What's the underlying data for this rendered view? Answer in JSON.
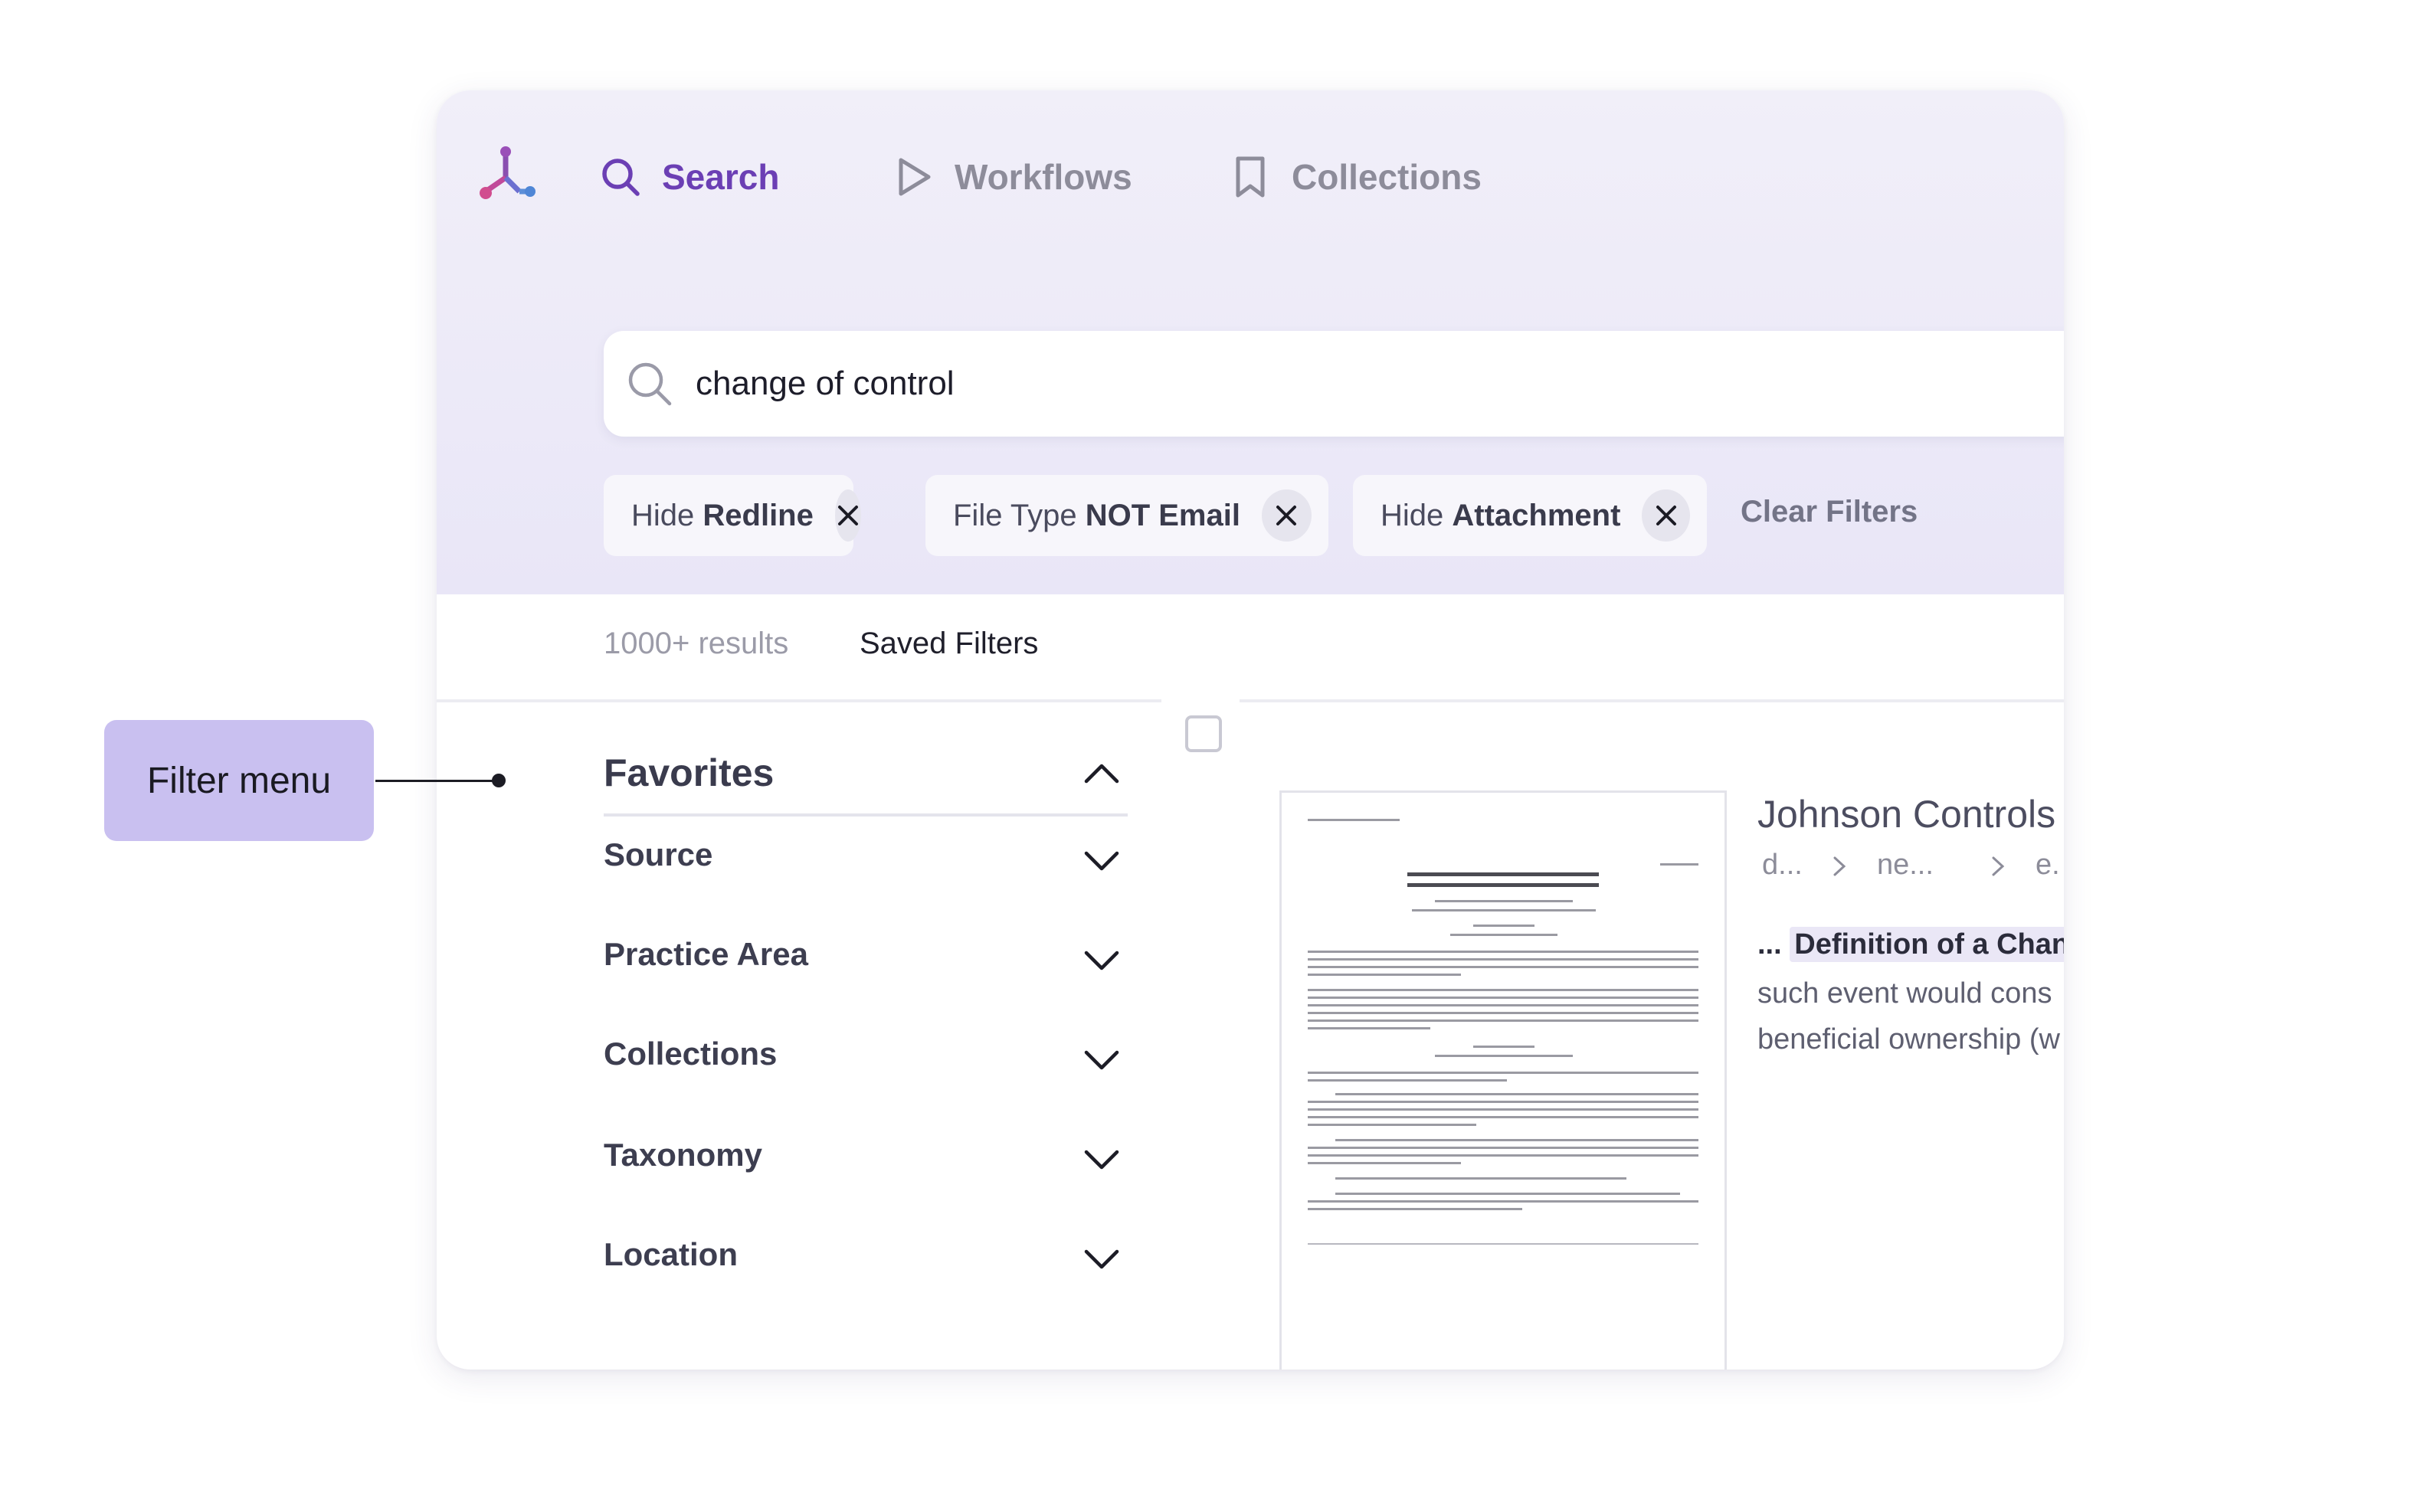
{
  "nav": {
    "tabs": [
      {
        "label": "Search",
        "icon": "search-icon",
        "active": true
      },
      {
        "label": "Workflows",
        "icon": "play-icon",
        "active": false
      },
      {
        "label": "Collections",
        "icon": "bookmark-icon",
        "active": false
      }
    ]
  },
  "search": {
    "value": "change of control"
  },
  "filters": {
    "chips": [
      {
        "prefix": "Hide ",
        "value": "Redline"
      },
      {
        "prefix": "File Type ",
        "value": "NOT Email"
      },
      {
        "prefix": "Hide ",
        "value": "Attachment"
      }
    ],
    "clear_label": "Clear Filters"
  },
  "results": {
    "count_label": "1000+ results",
    "saved_filters_label": "Saved Filters"
  },
  "filter_menu": {
    "favorites_label": "Favorites",
    "items": [
      "Source",
      "Practice Area",
      "Collections",
      "Taxonomy",
      "Location"
    ]
  },
  "result_card": {
    "title": "Johnson Controls",
    "breadcrumbs": [
      "d...",
      "ne...",
      "e."
    ],
    "snippet_prefix": "...",
    "snippet_highlight": "Definition of a Chang",
    "snippet_line2": "such event would cons",
    "snippet_line3": "beneficial ownership (w"
  },
  "callout": {
    "label": "Filter menu"
  },
  "colors": {
    "accent": "#6b3fb4",
    "callout_bg": "#c9c0f0",
    "header_bg": "#eceaf8"
  }
}
